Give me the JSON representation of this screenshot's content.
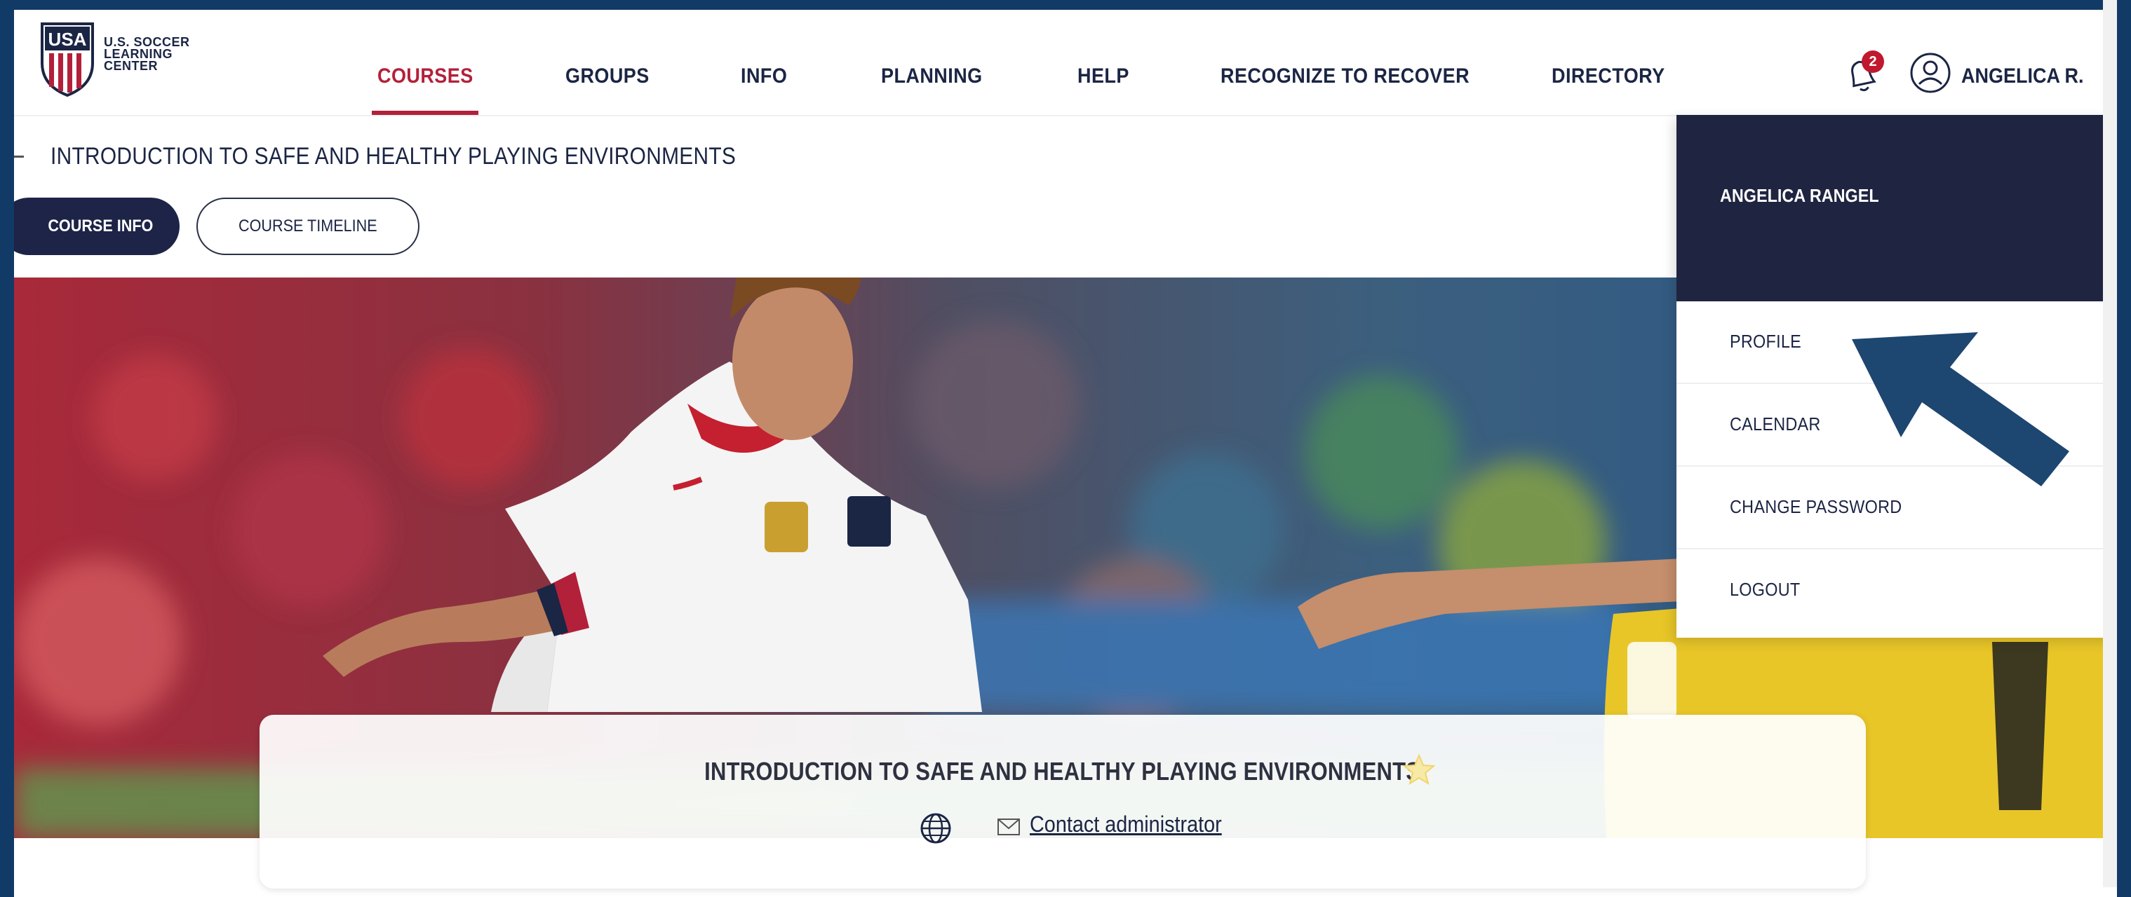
{
  "logo": {
    "line1": "U.S. SOCCER",
    "line2": "LEARNING",
    "line3": "CENTER",
    "badge_text": "USA"
  },
  "nav": {
    "items": [
      {
        "label": "COURSES"
      },
      {
        "label": "GROUPS"
      },
      {
        "label": "INFO"
      },
      {
        "label": "PLANNING"
      },
      {
        "label": "HELP"
      },
      {
        "label": "RECOGNIZE TO RECOVER"
      },
      {
        "label": "DIRECTORY"
      }
    ],
    "notification_count": "2",
    "user_label": "ANGELICA R."
  },
  "course": {
    "title": "INTRODUCTION TO SAFE AND HEALTHY PLAYING ENVIRONMENTS",
    "tabs": [
      {
        "label": "COURSE INFO"
      },
      {
        "label": "COURSE TIMELINE"
      }
    ],
    "card_title": "INTRODUCTION TO SAFE AND HEALTHY PLAYING ENVIRONMENTS",
    "contact_label": "Contact administrator"
  },
  "user_menu": {
    "full_name": "ANGELICA RANGEL",
    "items": [
      {
        "label": "PROFILE"
      },
      {
        "label": "CALENDAR"
      },
      {
        "label": "CHANGE PASSWORD"
      },
      {
        "label": "LOGOUT"
      }
    ]
  },
  "colors": {
    "accent": "#b3203a",
    "navy": "#1f2440",
    "frame": "#123a66"
  }
}
